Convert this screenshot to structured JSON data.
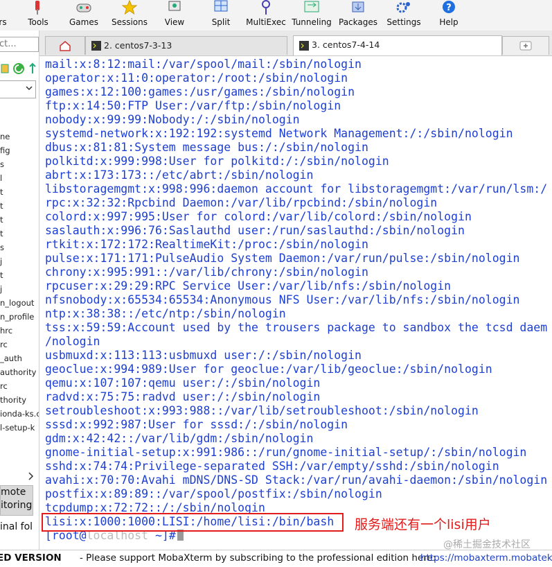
{
  "toolbar": {
    "items": [
      {
        "label": "rs",
        "icon": "servers-icon"
      },
      {
        "label": "Tools",
        "icon": "tools-icon"
      },
      {
        "label": "Games",
        "icon": "games-icon"
      },
      {
        "label": "Sessions",
        "icon": "star-icon"
      },
      {
        "label": "View",
        "icon": "view-icon"
      },
      {
        "label": "Split",
        "icon": "split-icon"
      },
      {
        "label": "MultiExec",
        "icon": "multiexec-icon"
      },
      {
        "label": "Tunneling",
        "icon": "tunneling-icon"
      },
      {
        "label": "Packages",
        "icon": "packages-icon"
      },
      {
        "label": "Settings",
        "icon": "gear-icon"
      },
      {
        "label": "Help",
        "icon": "help-icon"
      }
    ]
  },
  "sidebar": {
    "quick_connect": "ct...",
    "files": [
      "ne",
      "fig",
      "s",
      "l",
      "t",
      "t",
      "t",
      "t",
      "s",
      "j",
      "t",
      "j",
      "n_logout",
      "n_profile",
      "hrc",
      "rc",
      "_auth",
      "authority",
      "rc",
      "thority",
      "ionda-ks.c",
      "l-setup-k"
    ],
    "remote_monitoring": [
      "mote",
      "itoring"
    ],
    "terminal_folder": "inal fol"
  },
  "tabs": [
    {
      "label": "2. centos7-3-13",
      "active": false
    },
    {
      "label": "3. centos7-4-14",
      "active": true
    }
  ],
  "terminal": {
    "lines": [
      "mail:x:8:12:mail:/var/spool/mail:/sbin/nologin",
      "operator:x:11:0:operator:/root:/sbin/nologin",
      "games:x:12:100:games:/usr/games:/sbin/nologin",
      "ftp:x:14:50:FTP User:/var/ftp:/sbin/nologin",
      "nobody:x:99:99:Nobody:/:/sbin/nologin",
      "systemd-network:x:192:192:systemd Network Management:/:/sbin/nologin",
      "dbus:x:81:81:System message bus:/:/sbin/nologin",
      "polkitd:x:999:998:User for polkitd:/:/sbin/nologin",
      "abrt:x:173:173::/etc/abrt:/sbin/nologin",
      "libstoragemgmt:x:998:996:daemon account for libstoragemgmt:/var/run/lsm:/",
      "rpc:x:32:32:Rpcbind Daemon:/var/lib/rpcbind:/sbin/nologin",
      "colord:x:997:995:User for colord:/var/lib/colord:/sbin/nologin",
      "saslauth:x:996:76:Saslauthd user:/run/saslauthd:/sbin/nologin",
      "rtkit:x:172:172:RealtimeKit:/proc:/sbin/nologin",
      "pulse:x:171:171:PulseAudio System Daemon:/var/run/pulse:/sbin/nologin",
      "chrony:x:995:991::/var/lib/chrony:/sbin/nologin",
      "rpcuser:x:29:29:RPC Service User:/var/lib/nfs:/sbin/nologin",
      "nfsnobody:x:65534:65534:Anonymous NFS User:/var/lib/nfs:/sbin/nologin",
      "ntp:x:38:38::/etc/ntp:/sbin/nologin",
      "tss:x:59:59:Account used by the trousers package to sandbox the tcsd daem",
      "/nologin",
      "usbmuxd:x:113:113:usbmuxd user:/:/sbin/nologin",
      "geoclue:x:994:989:User for geoclue:/var/lib/geoclue:/sbin/nologin",
      "qemu:x:107:107:qemu user:/:/sbin/nologin",
      "radvd:x:75:75:radvd user:/:/sbin/nologin",
      "setroubleshoot:x:993:988::/var/lib/setroubleshoot:/sbin/nologin",
      "sssd:x:992:987:User for sssd:/:/sbin/nologin",
      "gdm:x:42:42::/var/lib/gdm:/sbin/nologin",
      "gnome-initial-setup:x:991:986::/run/gnome-initial-setup/:/sbin/nologin",
      "sshd:x:74:74:Privilege-separated SSH:/var/empty/sshd:/sbin/nologin",
      "avahi:x:70:70:Avahi mDNS/DNS-SD Stack:/var/run/avahi-daemon:/sbin/nologin",
      "postfix:x:89:89::/var/spool/postfix:/sbin/nologin",
      "tcpdump:x:72:72::/:/sbin/nologin",
      "lisi:x:1000:1000:LISI:/home/lisi:/bin/bash"
    ],
    "prompt_open": "[root@",
    "prompt_host": "localhost",
    "prompt_close": " ~]#",
    "annotation": "服务端还有一个lisi用户",
    "watermark": "@稀土掘金技术社区"
  },
  "statusbar": {
    "unregistered": "ED VERSION",
    "message": "-  Please support MobaXterm by subscribing to the professional edition here:",
    "link": "https://mobaxterm.mobatek"
  },
  "colors": {
    "terminal_text": "#1d3fd1",
    "annotation": "#e21b1b",
    "link": "#1a3fc9"
  }
}
